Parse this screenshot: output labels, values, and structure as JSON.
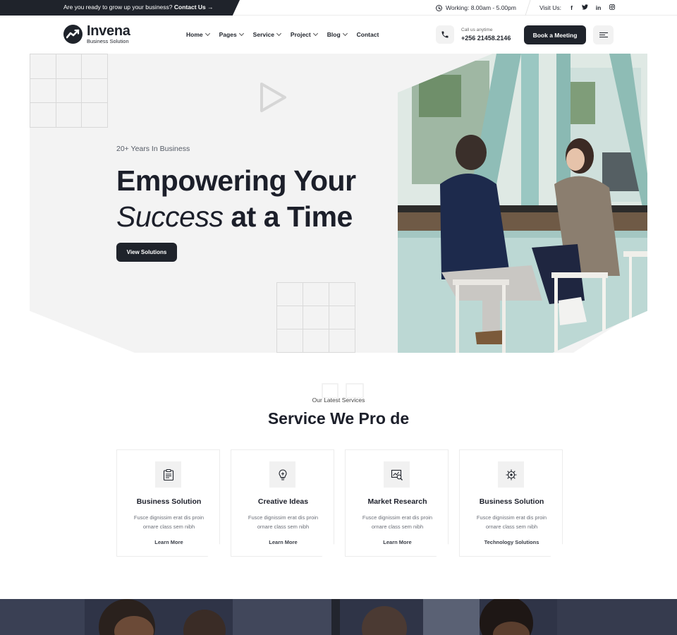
{
  "topbar": {
    "promo_text": "Are you ready to grow up your business?",
    "promo_link": "Contact Us",
    "hours": "Working: 8.00am - 5.00pm",
    "visit_label": "Visit Us:",
    "social": [
      "facebook-icon",
      "twitter-icon",
      "linkedin-icon",
      "instagram-icon"
    ]
  },
  "header": {
    "logo_name": "Invena",
    "logo_tagline": "Business Solution",
    "nav": [
      {
        "label": "Home",
        "dropdown": true
      },
      {
        "label": "Pages",
        "dropdown": true
      },
      {
        "label": "Service",
        "dropdown": true
      },
      {
        "label": "Project",
        "dropdown": true
      },
      {
        "label": "Blog",
        "dropdown": true
      },
      {
        "label": "Contact",
        "dropdown": false
      }
    ],
    "call_label": "Call us anytime",
    "call_number": "+256 21458.2146",
    "book_button": "Book a Meeting"
  },
  "hero": {
    "eyebrow": "20+ Years In Business",
    "title_line1": "Empowering Your",
    "title_italic": "Success",
    "title_rest": " at a Time",
    "cta": "View Solutions"
  },
  "services": {
    "eyebrow": "Our Latest Services",
    "title": "Service We Pro de",
    "cards": [
      {
        "icon": "clipboard-icon",
        "title": "Business Solution",
        "desc": "Fusce dignissim erat dis proin ornare class sem nibh",
        "link": "Learn More"
      },
      {
        "icon": "lightbulb-icon",
        "title": "Creative Ideas",
        "desc": "Fusce dignissim erat dis proin ornare class sem nibh",
        "link": "Learn More"
      },
      {
        "icon": "chart-search-icon",
        "title": "Market Research",
        "desc": "Fusce dignissim erat dis proin ornare class sem nibh",
        "link": "Learn More"
      },
      {
        "icon": "gear-bulb-icon",
        "title": "Business Solution",
        "desc": "Fusce dignissim erat dis proin ornare class sem nibh",
        "link": "Technology Solutions"
      }
    ]
  },
  "colors": {
    "primary_dark": "#1f232b",
    "hero_bg": "#f3f3f3",
    "text": "#1c1f2a"
  }
}
